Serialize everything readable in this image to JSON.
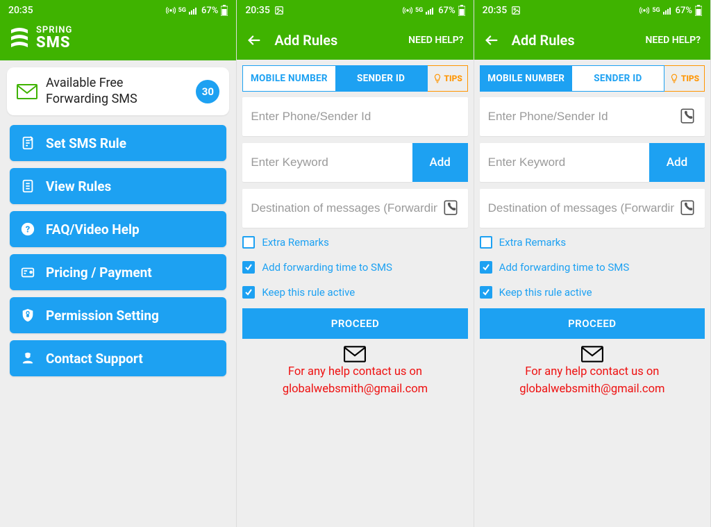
{
  "status": {
    "time": "20:35",
    "battery": "67%",
    "has_photo_icon_screens": [
      2,
      3
    ]
  },
  "colors": {
    "green": "#3fb300",
    "blue": "#1da1f2",
    "orange": "#ff9500",
    "red": "#ee1111"
  },
  "screen1": {
    "brand_top": "SPRING",
    "brand_bottom": "SMS",
    "free_card": {
      "label": "Available Free Forwarding SMS",
      "count": "30"
    },
    "menu": [
      {
        "icon": "rule",
        "label": "Set SMS Rule"
      },
      {
        "icon": "list",
        "label": "View Rules"
      },
      {
        "icon": "help",
        "label": "FAQ/Video Help"
      },
      {
        "icon": "pricing",
        "label": "Pricing / Payment"
      },
      {
        "icon": "shield",
        "label": "Permission Setting"
      },
      {
        "icon": "support",
        "label": "Contact Support"
      }
    ]
  },
  "add_rules": {
    "title": "Add Rules",
    "help": "NEED HELP?",
    "tabs": {
      "mobile": "MOBILE NUMBER",
      "sender": "SENDER ID",
      "tips": "TIPS"
    },
    "ph_sender": "Enter Phone/Sender Id",
    "ph_keyword": "Enter Keyword",
    "add": "Add",
    "ph_dest": "Destination of messages (Forwardin…",
    "checks": {
      "extra": "Extra Remarks",
      "time": "Add forwarding time to SMS",
      "active": "Keep this rule active"
    },
    "proceed": "PROCEED",
    "help_line1": "For any help contact us on",
    "help_line2": "globalwebsmith@gmail.com"
  },
  "screens": [
    {
      "active_tab": "mobile",
      "show_contact_on_sender": false
    },
    {
      "active_tab": "sender",
      "show_contact_on_sender": true
    }
  ]
}
